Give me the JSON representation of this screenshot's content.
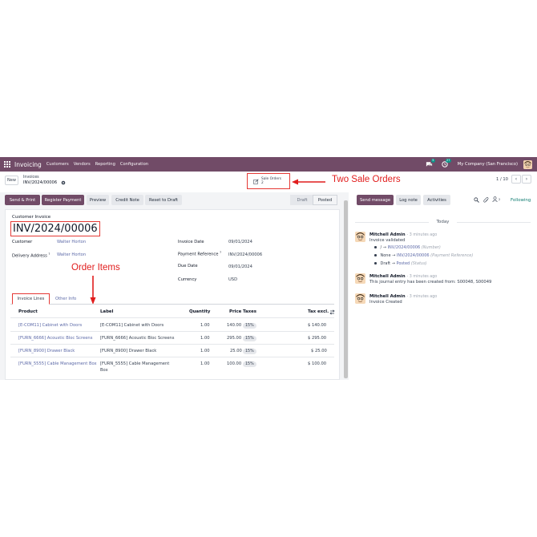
{
  "navbar": {
    "app_name": "Invoicing",
    "menu": [
      "Customers",
      "Vendors",
      "Reporting",
      "Configuration"
    ],
    "messages_badge": "5",
    "activities_badge": "27",
    "company": "My Company (San Francisco)"
  },
  "control_panel": {
    "new_label": "New",
    "breadcrumb_parent": "Invoices",
    "breadcrumb_current": "INV/2024/00006",
    "smart_button_label": "Sale Orders",
    "smart_button_count": "2",
    "pager_text": "1 / 10"
  },
  "annotations": {
    "sale_orders": "Two Sale Orders",
    "order_items": "Order Items",
    "color": "#e11d1d"
  },
  "actions": {
    "send_print": "Send & Print",
    "register_payment": "Register Payment",
    "preview": "Preview",
    "credit_note": "Credit Note",
    "reset_to_draft": "Reset to Draft"
  },
  "status": {
    "draft": "Draft",
    "posted": "Posted"
  },
  "form": {
    "title_label": "Customer Invoice",
    "invoice_number": "INV/2024/00006",
    "customer_label": "Customer",
    "customer_value": "Walter Horton",
    "delivery_label": "Delivery Address",
    "delivery_value": "Walter Horton",
    "invoice_date_label": "Invoice Date",
    "invoice_date_value": "09/01/2024",
    "payment_ref_label": "Payment Reference",
    "payment_ref_value": "INV/2024/00006",
    "due_date_label": "Due Date",
    "due_date_value": "09/01/2024",
    "currency_label": "Currency",
    "currency_value": "USD",
    "help_mark": "?"
  },
  "tabs": {
    "invoice_lines": "Invoice Lines",
    "other_info": "Other Info"
  },
  "table": {
    "headers": {
      "product": "Product",
      "label": "Label",
      "quantity": "Quantity",
      "price": "Price",
      "taxes": "Taxes",
      "tax_excl": "Tax excl."
    },
    "rows": [
      {
        "product": "[E-COM11] Cabinet with Doors",
        "label": "[E-COM11] Cabinet with Doors",
        "label2": "",
        "quantity": "1.00",
        "price": "140.00",
        "tax": "15%",
        "subtotal": "$ 140.00"
      },
      {
        "product": "[FURN_6666] Acoustic Bloc Screens",
        "label": "[FURN_6666] Acoustic Bloc Screens",
        "label2": "",
        "quantity": "1.00",
        "price": "295.00",
        "tax": "15%",
        "subtotal": "$ 295.00"
      },
      {
        "product": "[FURN_8900] Drawer Black",
        "label": "[FURN_8900] Drawer Black",
        "label2": "",
        "quantity": "1.00",
        "price": "25.00",
        "tax": "15%",
        "subtotal": "$ 25.00"
      },
      {
        "product": "[FURN_5555] Cable Management Box",
        "label": "[FURN_5555] Cable Management",
        "label2": "Box",
        "quantity": "1.00",
        "price": "100.00",
        "tax": "15%",
        "subtotal": "$ 100.00"
      }
    ]
  },
  "chatter": {
    "send_message": "Send message",
    "log_note": "Log note",
    "activities": "Activities",
    "followers_count": "2",
    "following": "Following",
    "today": "Today",
    "messages": [
      {
        "author": "Mitchell Admin",
        "time": "- 3 minutes ago",
        "body": "Invoice validated",
        "tracking": [
          {
            "old": "/",
            "new": "INV/2024/00006",
            "field": "(Number)"
          },
          {
            "old": "None",
            "new": "INV/2024/00006",
            "field": "(Payment Reference)"
          },
          {
            "old": "Draft",
            "new": "Posted",
            "field": "(Status)"
          }
        ]
      },
      {
        "author": "Mitchell Admin",
        "time": "- 3 minutes ago",
        "body": "This journal entry has been created from: S00048, S00049"
      },
      {
        "author": "Mitchell Admin",
        "time": "- 3 minutes ago",
        "body": "Invoice Created"
      }
    ]
  },
  "colors": {
    "brand": "#714b67",
    "link": "#5d6aa8",
    "annotation": "#e11d1d"
  }
}
